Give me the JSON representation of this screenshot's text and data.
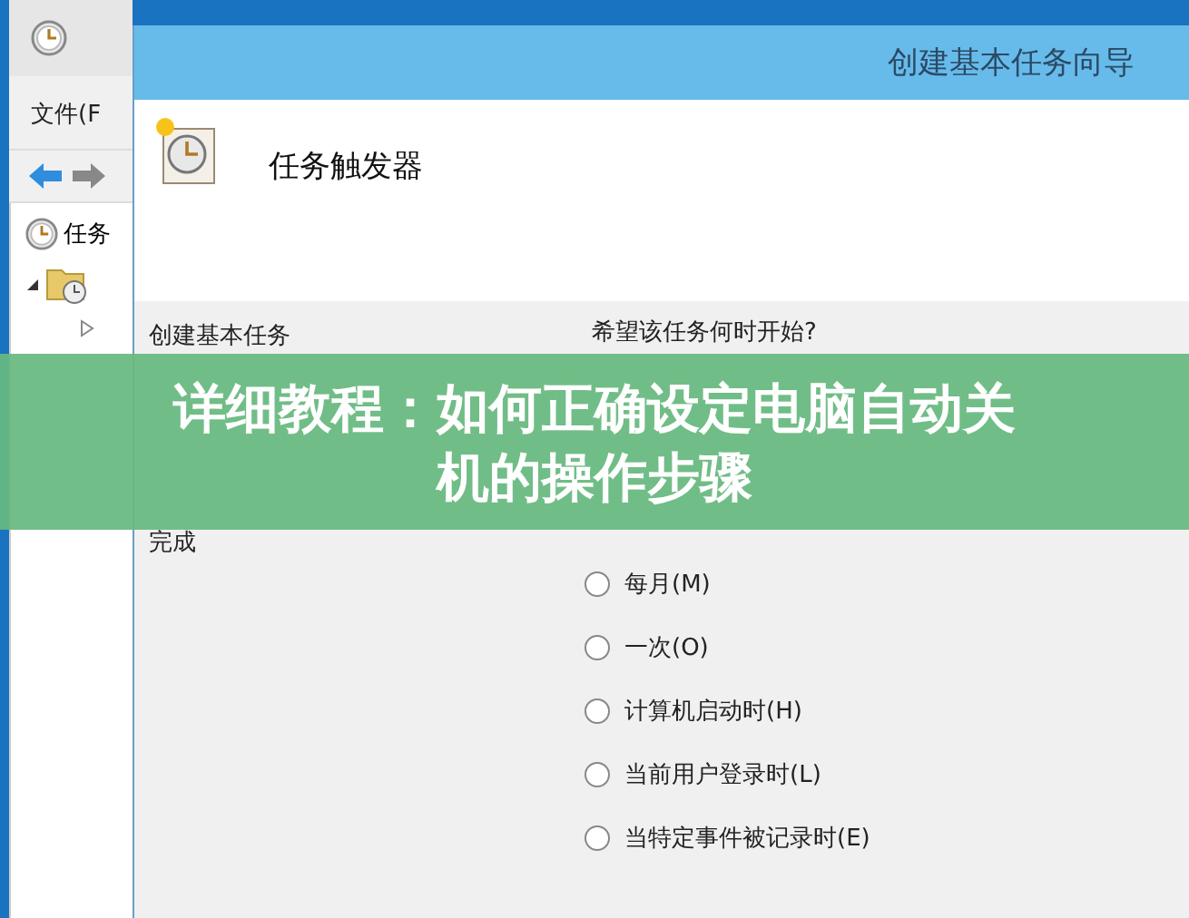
{
  "background_window": {
    "menu": "文件(F",
    "tree_root": "任务"
  },
  "dialog": {
    "title": "创建基本任务向导",
    "header": "任务触发器",
    "steps": [
      {
        "label": "创建基本任务"
      },
      {
        "label": "完成"
      }
    ],
    "question": "希望该任务何时开始?",
    "options": [
      {
        "label": "每月(M)",
        "selected": false
      },
      {
        "label": "一次(O)",
        "selected": false
      },
      {
        "label": "计算机启动时(H)",
        "selected": false
      },
      {
        "label": "当前用户登录时(L)",
        "selected": false
      },
      {
        "label": "当特定事件被记录时(E)",
        "selected": false
      }
    ]
  },
  "banner": {
    "lines": [
      "详细教程：如何正确设定电脑自动关",
      "机的操作步骤"
    ]
  }
}
